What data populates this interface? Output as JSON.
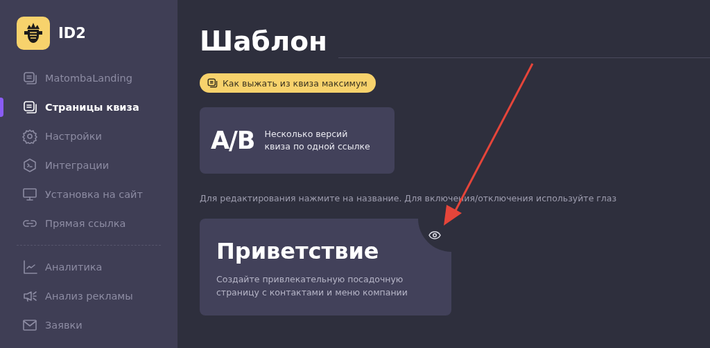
{
  "logo": {
    "text": "ID2"
  },
  "sidebar": {
    "sections": [
      {
        "items": [
          {
            "label": "MatombaLanding",
            "selected": false
          },
          {
            "label": "Страницы квиза",
            "selected": true
          },
          {
            "label": "Настройки",
            "selected": false
          },
          {
            "label": "Интеграции",
            "selected": false
          },
          {
            "label": "Установка на сайт",
            "selected": false
          },
          {
            "label": "Прямая ссылка",
            "selected": false
          }
        ]
      },
      {
        "items": [
          {
            "label": "Аналитика",
            "selected": false
          },
          {
            "label": "Анализ рекламы",
            "selected": false
          },
          {
            "label": "Заявки",
            "selected": false
          }
        ]
      }
    ]
  },
  "page": {
    "title": "Шаблон",
    "tip_button": "Как выжать из квиза максимум",
    "ab_card": {
      "badge": "A/B",
      "text": "Несколько версий квиза по одной ссылке"
    },
    "hint": "Для редактирования нажмите на название. Для включения/отключения используйте глаз",
    "cards": [
      {
        "title": "Приветствие",
        "description": "Создайте привлекательную посадочную страницу с контактами и меню компании",
        "visible": true
      }
    ]
  }
}
